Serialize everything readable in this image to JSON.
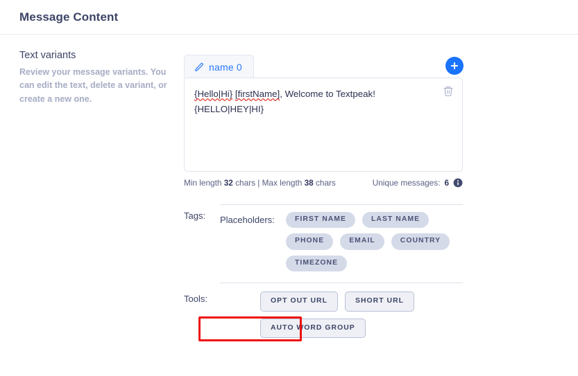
{
  "header": {
    "title": "Message Content"
  },
  "left_panel": {
    "title": "Text variants",
    "description": "Review your message variants. You can edit the text, delete a variant, or create a new one."
  },
  "variants": {
    "tab": {
      "label": "name 0",
      "edit_icon": "pencil-icon"
    },
    "add_button": {
      "icon": "plus-icon",
      "aria": "Add variant"
    },
    "editor": {
      "line1": "{Hello|Hi} [firstName], Welcome to Textpeak!",
      "line2": "{HELLO|HEY|HI}",
      "line1_misspelled_1": "{Hello|Hi}",
      "line1_misspelled_2": "[firstName]",
      "line1_rest": ", Welcome to Textpeak!",
      "delete_icon": "trash-icon"
    },
    "stats": {
      "min_label_pre": "Min length ",
      "min_value": "32",
      "min_label_post": " chars",
      "separator": " | ",
      "max_label_pre": "Max length ",
      "max_value": "38",
      "max_label_post": " chars",
      "unique_label": "Unique messages:",
      "unique_value": "6",
      "info_icon": "info-icon"
    }
  },
  "tags": {
    "label": "Tags:",
    "placeholders_label": "Placeholders:",
    "chips": [
      "FIRST NAME",
      "LAST NAME",
      "PHONE",
      "EMAIL",
      "COUNTRY",
      "TIMEZONE"
    ]
  },
  "tools": {
    "label": "Tools:",
    "buttons": [
      "OPT OUT URL",
      "SHORT URL",
      "AUTO WORD GROUP"
    ],
    "highlighted_button": "AUTO WORD GROUP"
  },
  "colors": {
    "accent_blue": "#1a73ff",
    "tab_text_blue": "#2979ff",
    "heading_navy": "#3d4466",
    "muted_gray": "#a7acc4",
    "chip_bg": "#d5dae9",
    "highlight_red": "#ee1111",
    "spellcheck_red": "#e8443a"
  }
}
